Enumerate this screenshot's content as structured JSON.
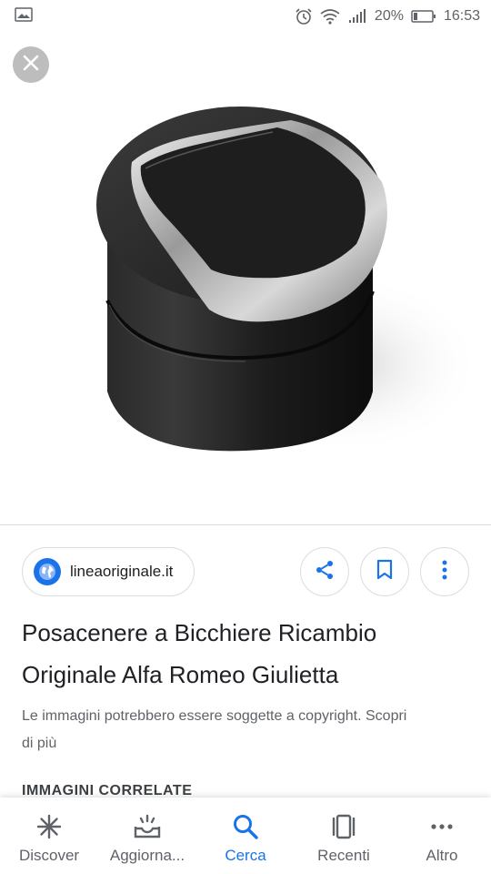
{
  "status_bar": {
    "battery": "20%",
    "time": "16:53"
  },
  "viewer": {
    "close_icon": "close-icon",
    "image_subject": "black cup-holder ashtray with chrome-rimmed lid"
  },
  "source": {
    "site": "lineaoriginale.it",
    "icon": "globe-icon"
  },
  "actions": {
    "share_icon": "share-icon",
    "save_icon": "bookmark-icon",
    "more_icon": "more-vert-icon"
  },
  "result": {
    "title_line1": "Posacenere a Bicchiere Ricambio",
    "title_line2": "Originale Alfa Romeo Giulietta",
    "copyright_line1": "Le immagini potrebbero essere soggette a copyright. Scopri",
    "copyright_line2": "di più",
    "related_header": "IMMAGINI CORRELATE"
  },
  "bottom_nav": {
    "items": [
      {
        "label": "Discover",
        "icon": "asterisk-icon",
        "active": false
      },
      {
        "label": "Aggiorna...",
        "icon": "updates-inbox-icon",
        "active": false
      },
      {
        "label": "Cerca",
        "icon": "search-icon",
        "active": true
      },
      {
        "label": "Recenti",
        "icon": "recent-tabs-icon",
        "active": false
      },
      {
        "label": "Altro",
        "icon": "more-horiz-icon",
        "active": false
      }
    ]
  },
  "colors": {
    "accent": "#1a73e8",
    "text_primary": "#202124",
    "text_secondary": "#5f6368",
    "divider": "#dadce0"
  }
}
